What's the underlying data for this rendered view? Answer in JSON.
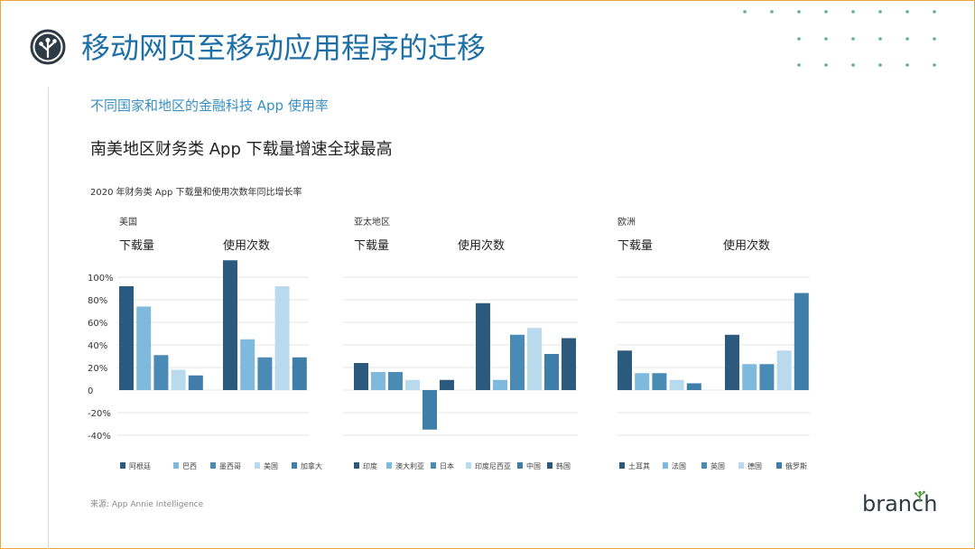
{
  "slide": {
    "title": "移动网页至移动应用程序的迁移",
    "subtitle": "不同国家和地区的金融科技 App 使用率",
    "headline": "南美地区财务类 App 下载量增速全球最高",
    "chart_title": "2020 年财务类 App 下载量和使用次数年同比增长率",
    "source": "来源: App Annie Intelligence",
    "brand": "branch",
    "logo_icon": "branch-tree-logo-icon"
  },
  "colors": {
    "title": "#1d6fa5",
    "accent_border": "#e8a33a",
    "series": [
      "#2b5a7e",
      "#7fbadd",
      "#4a8bb5",
      "#b9d9ec",
      "#3e7ea8"
    ]
  },
  "chart_data": {
    "type": "bar",
    "y_ticks": [
      "100%",
      "80%",
      "60%",
      "40%",
      "20%",
      "0",
      "-20%",
      "-40%"
    ],
    "ylim": [
      -40,
      100
    ],
    "groups": [
      {
        "region": "美国",
        "metrics": [
          "下载量",
          "使用次数"
        ],
        "legend": [
          "阿根廷",
          "巴西",
          "墨西哥",
          "美国",
          "加拿大"
        ],
        "downloads": [
          92,
          74,
          31,
          18,
          13
        ],
        "usage": [
          115,
          45,
          29,
          92,
          29
        ]
      },
      {
        "region": "亚太地区",
        "metrics": [
          "下载量",
          "使用次数"
        ],
        "legend": [
          "印度",
          "澳大利亚",
          "日本",
          "印度尼西亚",
          "中国",
          "韩国"
        ],
        "downloads": [
          24,
          16,
          16,
          9,
          -35,
          9
        ],
        "usage": [
          77,
          9,
          49,
          55,
          32,
          46
        ]
      },
      {
        "region": "欧洲",
        "metrics": [
          "下载量",
          "使用次数"
        ],
        "legend": [
          "土耳其",
          "法国",
          "英国",
          "德国",
          "俄罗斯"
        ],
        "downloads": [
          35,
          15,
          15,
          9,
          6
        ],
        "usage": [
          49,
          23,
          23,
          35,
          86
        ]
      }
    ]
  }
}
